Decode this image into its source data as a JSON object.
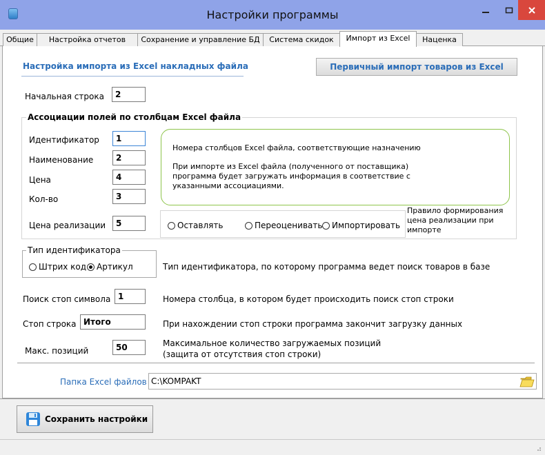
{
  "window": {
    "title": "Настройки программы",
    "minimize": "–",
    "maximize": "☐",
    "close": "✕"
  },
  "tabs": [
    {
      "label": "Общие",
      "active": false
    },
    {
      "label": "Настройка отчетов",
      "active": false
    },
    {
      "label": "Сохранение и управление БД",
      "active": false
    },
    {
      "label": "Система скидок",
      "active": false
    },
    {
      "label": "Импорт из Excel",
      "active": true
    },
    {
      "label": "Наценка",
      "active": false
    }
  ],
  "import": {
    "section_title": "Настройка импорта из Excel накладных файла",
    "primary_import_button": "Первичный импорт товаров из Excel",
    "start_row_label": "Начальная строка",
    "start_row_value": "2"
  },
  "associations": {
    "group_title": "Ассоциации полей по столбцам Excel файла",
    "fields": [
      {
        "label": "Идентификатор",
        "value": "1"
      },
      {
        "label": "Наименование",
        "value": "2"
      },
      {
        "label": "Цена",
        "value": "4"
      },
      {
        "label": "Кол-во",
        "value": "3"
      }
    ],
    "info_line1": "Номера столбцов Excel файла, соответствующие назначению",
    "info_line2": "При импорте из Excel файла (полученного от поставщика) программа будет загружать информация в соответствие с указанными ассоциациями.",
    "price_label": "Цена реализации",
    "price_value": "5",
    "price_options": [
      {
        "label": "Оставлять",
        "checked": false
      },
      {
        "label": "Переоценивать",
        "checked": false
      },
      {
        "label": "Импортировать",
        "checked": false
      }
    ],
    "price_rule_note": "Правило формирования цена реализации при импорте"
  },
  "identifier_type": {
    "group_title": "Тип идентификатора",
    "options": [
      {
        "label": "Штрих код",
        "checked": false
      },
      {
        "label": "Артикул",
        "checked": true
      }
    ],
    "description": "Тип идентификатора, по которому программа ведет поиск товаров в базе"
  },
  "stop_search": {
    "label": "Поиск стоп символа",
    "value": "1",
    "description": "Номера столбца, в котором будет происходить поиск стоп строки"
  },
  "stop_row": {
    "label": "Стоп строка",
    "value": "Итого",
    "description": "При нахождении стоп строки программа закончит загрузку данных"
  },
  "max_positions": {
    "label": "Макс. позиций",
    "value": "50",
    "description_line1": "Максимальное количество загружаемых позиций",
    "description_line2": "(защита от отсутствия стоп строки)"
  },
  "folder": {
    "label": "Папка Excel файлов",
    "value": "C:\\KOMPAKT"
  },
  "footer": {
    "save_button": "Сохранить настройки"
  },
  "colors": {
    "accent_blue": "#2a6db8",
    "title_bar": "#8fa3e8",
    "close_red": "#d9473d",
    "info_border_green": "#8dc44a"
  }
}
